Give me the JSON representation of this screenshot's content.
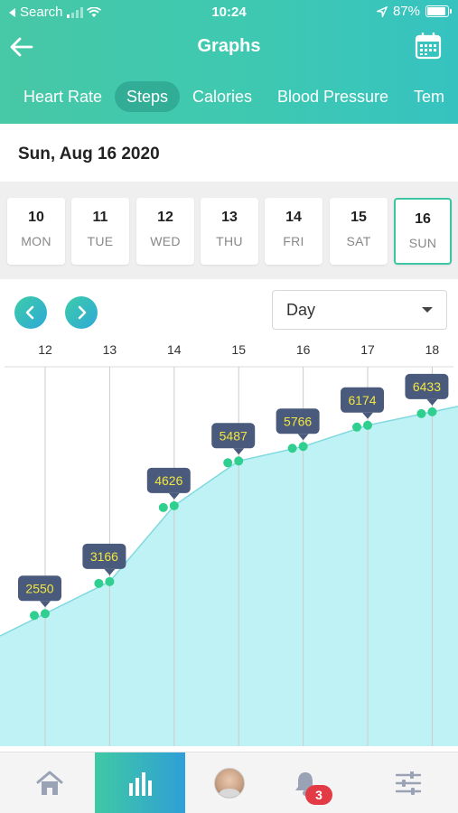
{
  "status_bar": {
    "back_app": "Search",
    "time": "10:24",
    "battery": "87%"
  },
  "header": {
    "title": "Graphs"
  },
  "tabs": [
    {
      "label": "Heart Rate",
      "active": false
    },
    {
      "label": "Steps",
      "active": true
    },
    {
      "label": "Calories",
      "active": false
    },
    {
      "label": "Blood Pressure",
      "active": false
    },
    {
      "label": "Tem",
      "active": false
    }
  ],
  "date_label": "Sun, Aug 16 2020",
  "days": [
    {
      "num": "10",
      "name": "MON",
      "selected": false
    },
    {
      "num": "11",
      "name": "TUE",
      "selected": false
    },
    {
      "num": "12",
      "name": "WED",
      "selected": false
    },
    {
      "num": "13",
      "name": "THU",
      "selected": false
    },
    {
      "num": "14",
      "name": "FRI",
      "selected": false
    },
    {
      "num": "15",
      "name": "SAT",
      "selected": false
    },
    {
      "num": "16",
      "name": "SUN",
      "selected": true
    }
  ],
  "range_select": {
    "value": "Day"
  },
  "colors": {
    "accent": "#3ec6a4",
    "area_fill": "#bff2f4",
    "area_line": "#7fd9df",
    "point": "#2ecf8f",
    "tooltip_bg": "#4a5a7c",
    "tooltip_text": "#f2e640",
    "badge": "#e23b45"
  },
  "chart_data": {
    "type": "area",
    "x": [
      12,
      13,
      14,
      15,
      16,
      17,
      18
    ],
    "series": [
      {
        "x": [
          12,
          13,
          14,
          15,
          16,
          17,
          18
        ],
        "values": [
          2550,
          3166,
          4626,
          5487,
          5766,
          6174,
          6433
        ]
      }
    ],
    "xlim": [
      11.3,
      18.4
    ],
    "ylim": [
      0,
      7300
    ],
    "grid": true
  },
  "bottom_nav": {
    "notification_count": "3",
    "items": [
      "home-icon",
      "graph-icon",
      "avatar",
      "bell-icon",
      "settings-sliders-icon"
    ]
  }
}
